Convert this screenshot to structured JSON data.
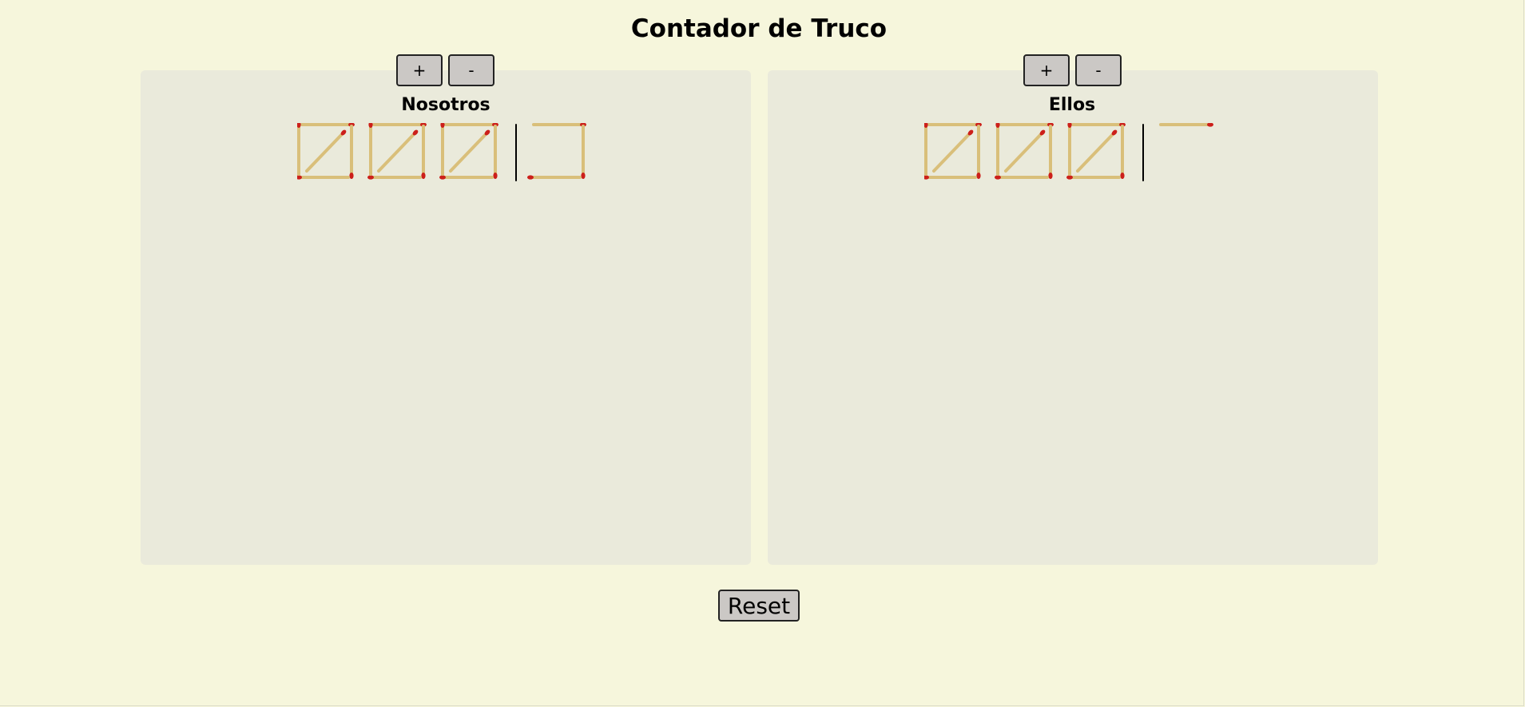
{
  "title": "Contador de Truco",
  "controls": {
    "plus_label": "+",
    "minus_label": "-",
    "reset_label": "Reset"
  },
  "teams": [
    {
      "name": "Nosotros",
      "points": 18
    },
    {
      "name": "Ellos",
      "points": 16
    }
  ],
  "colors": {
    "background": "#f6f6dc",
    "panel": "#eaeadb",
    "button": "#cbc8c5",
    "match_stick": "#d9bf7a",
    "match_head": "#cc1f1a",
    "divider": "#000000"
  },
  "icons": [
    "matchstick-icon"
  ]
}
